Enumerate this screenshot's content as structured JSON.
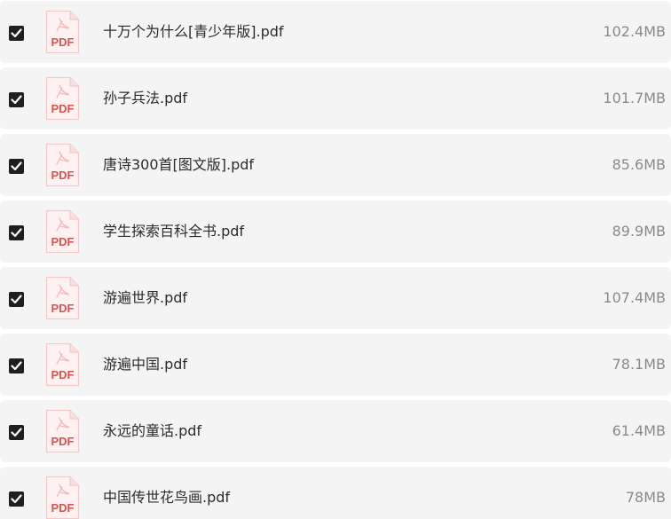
{
  "files": [
    {
      "name": "十万个为什么[青少年版].pdf",
      "size": "102.4MB",
      "checked": true,
      "icon": "pdf-file-icon",
      "icon_text": "PDF"
    },
    {
      "name": "孙子兵法.pdf",
      "size": "101.7MB",
      "checked": true,
      "icon": "pdf-file-icon",
      "icon_text": "PDF"
    },
    {
      "name": "唐诗300首[图文版].pdf",
      "size": "85.6MB",
      "checked": true,
      "icon": "pdf-file-icon",
      "icon_text": "PDF"
    },
    {
      "name": "学生探索百科全书.pdf",
      "size": "89.9MB",
      "checked": true,
      "icon": "pdf-file-icon",
      "icon_text": "PDF"
    },
    {
      "name": "游遍世界.pdf",
      "size": "107.4MB",
      "checked": true,
      "icon": "pdf-file-icon",
      "icon_text": "PDF"
    },
    {
      "name": "游遍中国.pdf",
      "size": "78.1MB",
      "checked": true,
      "icon": "pdf-file-icon",
      "icon_text": "PDF"
    },
    {
      "name": "永远的童话.pdf",
      "size": "61.4MB",
      "checked": true,
      "icon": "pdf-file-icon",
      "icon_text": "PDF"
    },
    {
      "name": "中国传世花鸟画.pdf",
      "size": "78MB",
      "checked": true,
      "icon": "pdf-file-icon",
      "icon_text": "PDF"
    }
  ],
  "colors": {
    "row_background": "#f4f4f5",
    "checkbox_fill": "#1f1f1f",
    "pdf_red": "#d9534f",
    "name_text": "#2b2b2b",
    "size_text": "#8a8a8a"
  }
}
